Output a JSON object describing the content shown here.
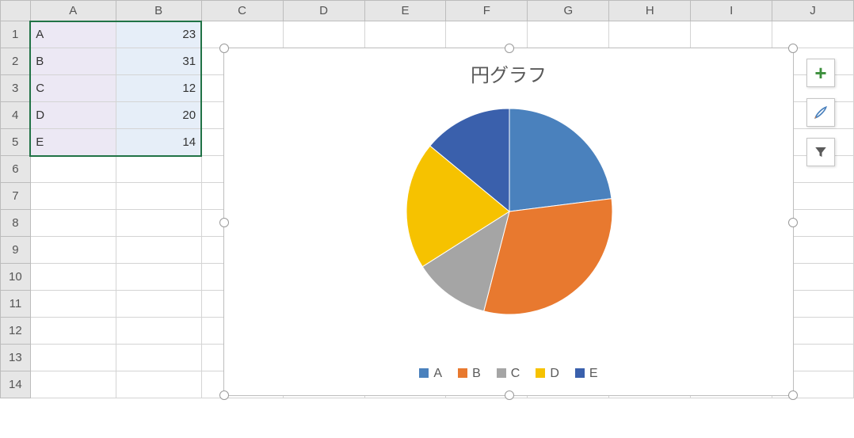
{
  "columns": [
    "A",
    "B",
    "C",
    "D",
    "E",
    "F",
    "G",
    "H",
    "I",
    "J"
  ],
  "row_count": 14,
  "data_rows": [
    {
      "label": "A",
      "value": 23
    },
    {
      "label": "B",
      "value": 31
    },
    {
      "label": "C",
      "value": 12
    },
    {
      "label": "D",
      "value": 20
    },
    {
      "label": "E",
      "value": 14
    }
  ],
  "chart_data": {
    "type": "pie",
    "title": "円グラフ",
    "categories": [
      "A",
      "B",
      "C",
      "D",
      "E"
    ],
    "values": [
      23,
      31,
      12,
      20,
      14
    ],
    "colors": [
      "#4a81bd",
      "#e8792f",
      "#a5a5a5",
      "#f6c200",
      "#3a60ac"
    ]
  },
  "side_tools": [
    {
      "name": "chart-elements-add-button"
    },
    {
      "name": "chart-styles-button"
    },
    {
      "name": "chart-filter-button"
    }
  ]
}
